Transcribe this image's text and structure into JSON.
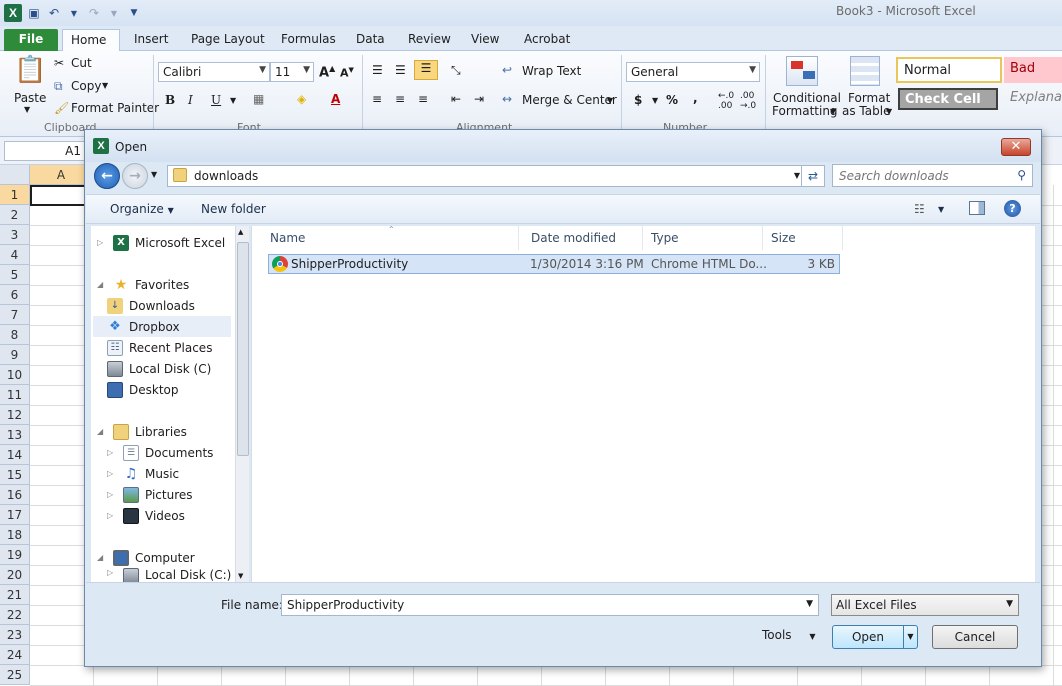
{
  "app": {
    "window_title": "Book3  -  Microsoft Excel",
    "quick_access": {
      "logo_text": "X"
    }
  },
  "ribbon": {
    "tabs": [
      "File",
      "Home",
      "Insert",
      "Page Layout",
      "Formulas",
      "Data",
      "Review",
      "View",
      "Acrobat"
    ],
    "clipboard": {
      "paste": "Paste",
      "cut": "Cut",
      "copy": "Copy",
      "format_painter": "Format Painter",
      "group_label": "Clipboard"
    },
    "font": {
      "name": "Calibri",
      "size": "11",
      "group_label": "Font",
      "bold": "B",
      "italic": "I",
      "underline": "U"
    },
    "alignment": {
      "wrap_text": "Wrap Text",
      "merge_center": "Merge & Center",
      "group_label": "Alignment"
    },
    "number": {
      "format": "General",
      "currency": "$",
      "percent": "%",
      "comma": ",",
      "group_label": "Number"
    },
    "styles": {
      "conditional_formatting_1": "Conditional",
      "conditional_formatting_2": "Formatting",
      "format_as_table_1": "Format",
      "format_as_table_2": "as Table",
      "normal": "Normal",
      "bad": "Bad",
      "check_cell": "Check Cell",
      "explanatory": "Explanat"
    }
  },
  "formula_bar": {
    "name_box": "A1"
  },
  "sheet": {
    "columns": [
      "A"
    ],
    "rows": [
      "1",
      "2",
      "3",
      "4",
      "5",
      "6",
      "7",
      "8",
      "9",
      "10",
      "11",
      "12",
      "13",
      "14",
      "15",
      "16",
      "17",
      "18",
      "19",
      "20",
      "21",
      "22",
      "23",
      "24",
      "25"
    ],
    "active_cell": "A1"
  },
  "dialog": {
    "title": "Open",
    "address": "downloads",
    "search_placeholder": "Search downloads",
    "commands": {
      "organize": "Organize",
      "new_folder": "New folder"
    },
    "nav": {
      "microsoft_excel": "Microsoft Excel",
      "favorites": "Favorites",
      "downloads": "Downloads",
      "dropbox": "Dropbox",
      "recent_places": "Recent Places",
      "local_disk": "Local Disk (C)",
      "desktop": "Desktop",
      "libraries": "Libraries",
      "documents": "Documents",
      "music": "Music",
      "pictures": "Pictures",
      "videos": "Videos",
      "computer": "Computer",
      "local_disk_2": "Local Disk (C:)"
    },
    "columns": {
      "name": "Name",
      "date_modified": "Date modified",
      "type": "Type",
      "size": "Size"
    },
    "files": [
      {
        "name": "ShipperProductivity",
        "date_modified": "1/30/2014 3:16 PM",
        "type": "Chrome HTML Do...",
        "size": "3 KB"
      }
    ],
    "file_name_label": "File name:",
    "file_name_value": "ShipperProductivity",
    "file_type": "All Excel Files",
    "tools": "Tools",
    "open_button": "Open",
    "cancel_button": "Cancel"
  },
  "colors": {
    "file_tab": "#2e8b3a",
    "excel_green": "#1e7145",
    "selected_row": "#d5e4f6",
    "close_button": "#c7432a",
    "bad_style_bg": "#ffc7ce",
    "check_cell_bg": "#a5a5a5"
  }
}
